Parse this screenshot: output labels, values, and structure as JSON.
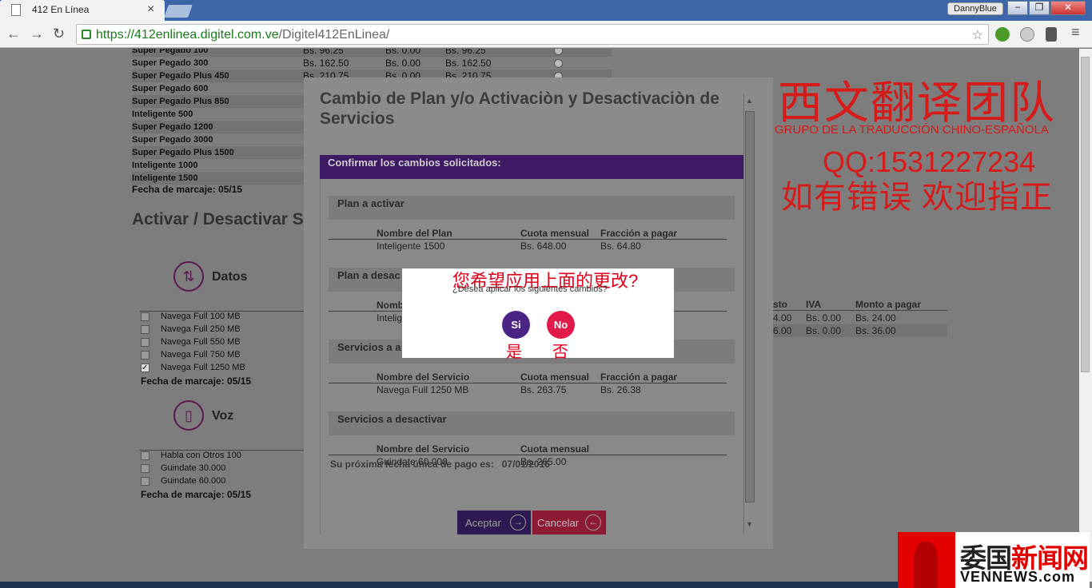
{
  "browser": {
    "tab_title": "412 En Línea",
    "tab_close": "×",
    "user": "DannyBlue",
    "url_host": "https://412enlinea.digitel.com.ve",
    "url_path": "/Digitel412EnLinea/",
    "nav_back": "←",
    "nav_forward": "→",
    "nav_reload": "↻",
    "menu": "≡",
    "win_min": "−",
    "win_max": "❐",
    "win_close": "✕"
  },
  "background": {
    "plans": [
      {
        "name": "Super Pegado 100",
        "a": "Bs.  96.25",
        "b": "Bs. 0.00",
        "c": "Bs.  96.25"
      },
      {
        "name": "Super Pegado 300",
        "a": "Bs.  162.50",
        "b": "Bs. 0.00",
        "c": "Bs.  162.50"
      },
      {
        "name": "Super Pegado Plus 450",
        "a": "Bs.  210.75",
        "b": "Bs. 0.00",
        "c": "Bs.  210.75"
      },
      {
        "name": "Super Pegado 600"
      },
      {
        "name": "Super Pegado Plus 850"
      },
      {
        "name": "Inteligente 500"
      },
      {
        "name": "Super Pegado 1200"
      },
      {
        "name": "Super Pegado 3000"
      },
      {
        "name": "Super Pegado Plus 1500"
      },
      {
        "name": "Inteligente 1000"
      },
      {
        "name": "Inteligente 1500"
      }
    ],
    "marcaje1": "Fecha de marcaje: 05/15",
    "heading": "Activar / Desactivar S",
    "datos_label": "Datos",
    "datos_items": [
      "Navega Full 100 MB",
      "Navega Full 250 MB",
      "Navega Full 550 MB",
      "Navega Full 750 MB",
      "Navega Full 1250 MB"
    ],
    "marcaje2": "Fecha de marcaje: 05/15",
    "voz_label": "Voz",
    "voz_items": [
      "Habla con Otros 100",
      "Guindate 30.000",
      "Guindate 60.000"
    ],
    "marcaje3": "Fecha de marcaje: 05/15",
    "right_headers": {
      "costo": "sto",
      "iva": "IVA",
      "monto": "Monto a pagar"
    },
    "right_rows": [
      {
        "costo": "4.00",
        "iva": "Bs. 0.00",
        "monto": "Bs.    24.00"
      },
      {
        "costo": "6.00",
        "iva": "Bs. 0.00",
        "monto": "Bs.    36.00"
      }
    ]
  },
  "modal": {
    "title": "Cambio de Plan y/o Activaciòn y Desactivaciòn de Servicios",
    "confirm_header": "Confirmar los cambios solicitados:",
    "sec_activar": "Plan a activar",
    "th_plan": "Nombre del Plan",
    "th_cuota": "Cuota mensual",
    "th_fraccion": "Fracción a pagar",
    "act_plan": "Inteligente 1500",
    "act_cuota": "Bs.   648.00",
    "act_fraccion": "Bs.     64.80",
    "sec_desactivar": "Plan a desac",
    "des_th_plan": "Nombr",
    "des_plan": "Intelig",
    "sec_serv_act": "Servicios a a",
    "th_servicio": "Nombre del Servicio",
    "sa_name": "Navega Full 1250 MB",
    "sa_cuota": "Bs.  263.75",
    "sa_fraccion": "Bs.     26.38",
    "sec_serv_des": "Servicios a desactivar",
    "sd_name": "Guindate 60.000",
    "sd_cuota": "Bs.  265.00",
    "payment_label": "Su próxima fecha única de pago es:",
    "payment_date": "07/01/2016",
    "accept": "Aceptar",
    "cancel": "Cancelar"
  },
  "confirm": {
    "zh_question": "您希望应用上面的更改?",
    "question": "¿Desea aplicar los siguientes cambios?",
    "yes": "Si",
    "no": "No",
    "zh_yes": "是",
    "zh_no": "否"
  },
  "watermark": {
    "line1": "西文翻译团队",
    "line2": "GRUPO DE LA TRADUCCIÓN CHINO-ESPAÑOLA",
    "line3": "QQ:1531227234",
    "line4": "如有错误  欢迎指正"
  },
  "logo": {
    "text_black": "委国",
    "text_red": "新闻网",
    "sub": "VENNEWS.com"
  },
  "colors": {
    "accent_purple": "#4a2586",
    "accent_red": "#e21a4a",
    "watermark_red": "#d71a1a"
  }
}
